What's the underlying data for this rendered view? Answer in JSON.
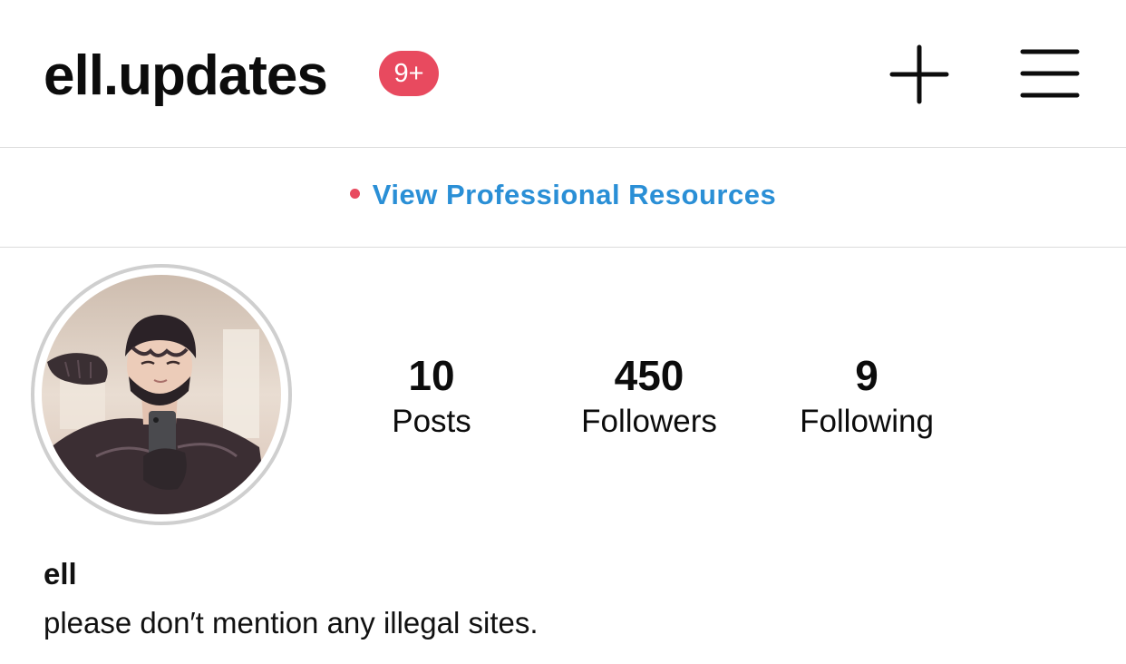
{
  "header": {
    "username": "ell.updates",
    "notification_badge": "9+",
    "badge_color": "#e84a5f",
    "new_post_icon": "plus-icon",
    "menu_icon": "hamburger-menu-icon"
  },
  "professional": {
    "link_label": "View Professional Resources",
    "link_color": "#2a8fd6",
    "indicator_color": "#e84a5f"
  },
  "profile": {
    "avatar_icon": "profile-avatar",
    "stats": [
      {
        "value": "10",
        "label": "Posts"
      },
      {
        "value": "450",
        "label": "Followers"
      },
      {
        "value": "9",
        "label": "Following"
      }
    ],
    "display_name": "ell",
    "bio": "please don′t mention any illegal sites."
  }
}
